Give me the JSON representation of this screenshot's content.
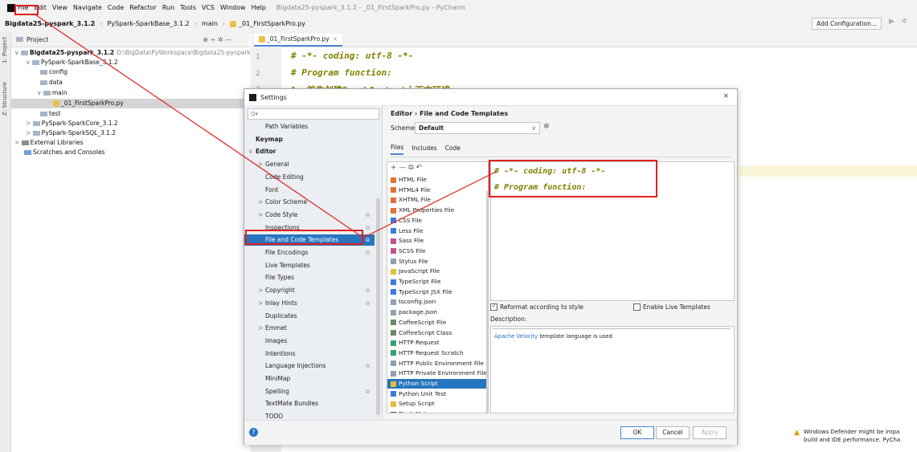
{
  "menubar": {
    "items": [
      "File",
      "Edit",
      "View",
      "Navigate",
      "Code",
      "Refactor",
      "Run",
      "Tools",
      "VCS",
      "Window",
      "Help"
    ],
    "window_title": "Bigdata25-pyspark_3.1.2 - _01_FirstSparkPro.py - PyCharm"
  },
  "navbar": {
    "crumbs": [
      "Bigdata25-pyspark_3.1.2",
      "PySpark-SparkBase_3.1.2",
      "main",
      "_01_FirstSparkPro.py"
    ],
    "add_config": "Add Configuration...",
    "run_icon": "▶",
    "debug_icon": "✲"
  },
  "stripe": {
    "project_tab": "1: Project",
    "structure_tab": "Z: Structure"
  },
  "project": {
    "header": "Project",
    "header_tools": "⊕  ÷  ✲  —",
    "tree": [
      {
        "label": "Bigdata25-pyspark_3.1.2",
        "suffix": "D:\\BigData\\PyWorkspace\\Bigdata25-pyspark_3",
        "kind": "folder",
        "arrow": "∨"
      },
      {
        "label": "PySpark-SparkBase_3.1.2",
        "suffix": "",
        "kind": "folder",
        "arrow": "∨"
      },
      {
        "label": "config",
        "suffix": "",
        "kind": "folder",
        "arrow": ""
      },
      {
        "label": "data",
        "suffix": "",
        "kind": "folder",
        "arrow": ""
      },
      {
        "label": "main",
        "suffix": "",
        "kind": "folder",
        "arrow": "∨"
      },
      {
        "label": "_01_FirstSparkPro.py",
        "suffix": "",
        "kind": "py",
        "arrow": ""
      },
      {
        "label": "test",
        "suffix": "",
        "kind": "folder",
        "arrow": ""
      },
      {
        "label": "PySpark-SparkCore_3.1.2",
        "suffix": "",
        "kind": "folder",
        "arrow": ">"
      },
      {
        "label": "PySpark-SparkSQL_3.1.2",
        "suffix": "",
        "kind": "folder",
        "arrow": ">"
      },
      {
        "label": "External Libraries",
        "suffix": "",
        "kind": "lib",
        "arrow": ">"
      },
      {
        "label": "Scratches and Consoles",
        "suffix": "",
        "kind": "scratch",
        "arrow": ""
      }
    ]
  },
  "editor": {
    "tab_label": "_01_FirstSparkPro.py",
    "line_numbers": [
      "1",
      "2",
      "3"
    ],
    "lines": [
      "# -*- coding: utf-8 -*-",
      "# Program function:",
      "1. 首先创建SparkContext上下文环境"
    ]
  },
  "dialog": {
    "title": "Settings",
    "close": "×",
    "search_placeholder": "Q▾",
    "nav": [
      {
        "label": "Path Variables",
        "indent": 1,
        "copy": false,
        "arrow": ""
      },
      {
        "label": "Keymap",
        "indent": 0,
        "copy": false,
        "arrow": "",
        "bold": true
      },
      {
        "label": "Editor",
        "indent": 0,
        "copy": false,
        "arrow": "∨",
        "bold": true
      },
      {
        "label": "General",
        "indent": 1,
        "copy": false,
        "arrow": ">"
      },
      {
        "label": "Code Editing",
        "indent": 1,
        "copy": false,
        "arrow": ""
      },
      {
        "label": "Font",
        "indent": 1,
        "copy": false,
        "arrow": ""
      },
      {
        "label": "Color Scheme",
        "indent": 1,
        "copy": false,
        "arrow": ">"
      },
      {
        "label": "Code Style",
        "indent": 1,
        "copy": true,
        "arrow": ">"
      },
      {
        "label": "Inspections",
        "indent": 1,
        "copy": true,
        "arrow": ""
      },
      {
        "label": "File and Code Templates",
        "indent": 1,
        "copy": true,
        "arrow": "",
        "selected": true
      },
      {
        "label": "File Encodings",
        "indent": 1,
        "copy": true,
        "arrow": ""
      },
      {
        "label": "Live Templates",
        "indent": 1,
        "copy": false,
        "arrow": ""
      },
      {
        "label": "File Types",
        "indent": 1,
        "copy": false,
        "arrow": ""
      },
      {
        "label": "Copyright",
        "indent": 1,
        "copy": true,
        "arrow": ">"
      },
      {
        "label": "Inlay Hints",
        "indent": 1,
        "copy": true,
        "arrow": ">"
      },
      {
        "label": "Duplicates",
        "indent": 1,
        "copy": false,
        "arrow": ""
      },
      {
        "label": "Emmet",
        "indent": 1,
        "copy": false,
        "arrow": ">"
      },
      {
        "label": "Images",
        "indent": 1,
        "copy": false,
        "arrow": ""
      },
      {
        "label": "Intentions",
        "indent": 1,
        "copy": false,
        "arrow": ""
      },
      {
        "label": "Language Injections",
        "indent": 1,
        "copy": true,
        "arrow": ""
      },
      {
        "label": "MiniMap",
        "indent": 1,
        "copy": false,
        "arrow": ""
      },
      {
        "label": "Spelling",
        "indent": 1,
        "copy": true,
        "arrow": ""
      },
      {
        "label": "TextMate Bundles",
        "indent": 1,
        "copy": false,
        "arrow": ""
      },
      {
        "label": "TODO",
        "indent": 1,
        "copy": false,
        "arrow": ""
      }
    ],
    "copy_icon": "⧉",
    "breadcrumb": "Editor  ›  File and Code Templates",
    "scheme_label": "Scheme:",
    "scheme_value": "Default",
    "scheme_arrow": "∨",
    "scheme_gear": "✲",
    "subtabs": [
      "Files",
      "Includes",
      "Code"
    ],
    "active_subtab": 0,
    "list_toolbar": "+  —  ⧉  ↶",
    "templates": [
      {
        "label": "HTML File",
        "color": "#e0733a"
      },
      {
        "label": "HTML4 File",
        "color": "#e0733a"
      },
      {
        "label": "XHTML File",
        "color": "#e0733a"
      },
      {
        "label": "XML Properties File",
        "color": "#e0733a"
      },
      {
        "label": "CSS File",
        "color": "#3a7be0"
      },
      {
        "label": "Less File",
        "color": "#3a7be0"
      },
      {
        "label": "Sass File",
        "color": "#c05590"
      },
      {
        "label": "SCSS File",
        "color": "#c05590"
      },
      {
        "label": "Stylus File",
        "color": "#8fa0b0"
      },
      {
        "label": "JavaScript File",
        "color": "#e0c03a"
      },
      {
        "label": "TypeScript File",
        "color": "#3a7be0"
      },
      {
        "label": "TypeScript JSX File",
        "color": "#3a7be0"
      },
      {
        "label": "tsconfig.json",
        "color": "#8fa0b0"
      },
      {
        "label": "package.json",
        "color": "#8fa0b0"
      },
      {
        "label": "CoffeeScript File",
        "color": "#6c8a6c"
      },
      {
        "label": "CoffeeScript Class",
        "color": "#6c8a6c"
      },
      {
        "label": "HTTP Request",
        "color": "#3aa06b"
      },
      {
        "label": "HTTP Request Scratch",
        "color": "#3aa06b"
      },
      {
        "label": "HTTP Public Environment File",
        "color": "#8fa0b0"
      },
      {
        "label": "HTTP Private Environment File",
        "color": "#8fa0b0"
      },
      {
        "label": "Python Script",
        "color": "#e0c03a",
        "selected": true
      },
      {
        "label": "Python Unit Test",
        "color": "#3a7be0"
      },
      {
        "label": "Setup Script",
        "color": "#e0c03a"
      },
      {
        "label": "Flask Main",
        "color": "#555555"
      }
    ],
    "template_code": [
      "# -*- coding: utf-8 -*-",
      "# Program function:"
    ],
    "reformat_label": "Reformat according to style",
    "reformat_checked": "✓",
    "live_templates_label": "Enable Live Templates",
    "description_label": "Description:",
    "description_link": "Apache Velocity",
    "description_rest": " template language is used",
    "help": "?",
    "ok": "OK",
    "cancel": "Cancel",
    "apply": "Apply"
  },
  "notification": {
    "icon": "▲",
    "line1": "Windows Defender might be impa",
    "line2": "build and IDE performance. PyCha"
  },
  "colors": {
    "accent": "#2675bf",
    "annotation": "#e02020",
    "code_comment": "#808000"
  }
}
